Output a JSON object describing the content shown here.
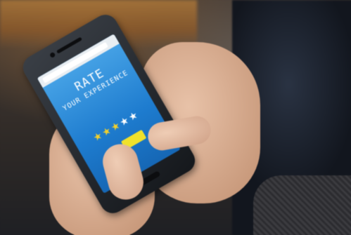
{
  "photo": {
    "phone_screen": {
      "headline": "RATE",
      "subheadline": "YOUR EXPERIENCE",
      "rating": {
        "filled": 3,
        "total": 5
      },
      "button_color": "#f0e12b",
      "screen_color": "#1e7ccf",
      "star_on_color": "#f3d02b",
      "star_off_color": "#ffffff"
    }
  }
}
